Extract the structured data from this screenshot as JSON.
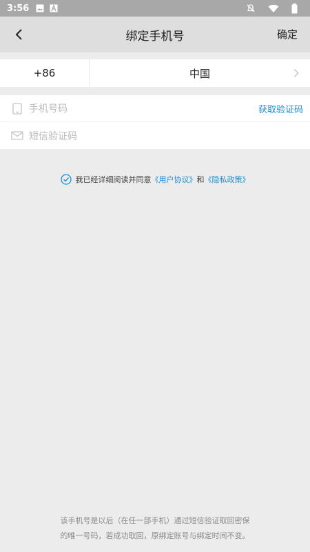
{
  "status_bar": {
    "time": "3:56",
    "icons": [
      "image-icon",
      "a-icon",
      "mute-icon",
      "wifi-icon",
      "battery-icon"
    ]
  },
  "header": {
    "title": "绑定手机号",
    "confirm_label": "确定",
    "back_icon": "back-arrow-icon"
  },
  "country_row": {
    "code": "+86",
    "country": "中国"
  },
  "phone_field": {
    "placeholder": "手机号码",
    "get_code_label": "获取验证码"
  },
  "sms_field": {
    "placeholder": "短信验证码"
  },
  "agreement": {
    "prefix": "我已经详细阅读并同意",
    "user_agreement": "《用户协议》",
    "and": "和",
    "privacy_policy": "《隐私政策》"
  },
  "footnote": {
    "line1": "该手机号是以后（在任一部手机）通过短信验证取回密保",
    "line2": "的唯一号码，若成功取回，原绑定账号与绑定时间不变。"
  },
  "colors": {
    "accent": "#1a8fd6",
    "background": "#ececec",
    "header_bg": "#dedede",
    "status_bar_bg": "#a8a8a8"
  }
}
